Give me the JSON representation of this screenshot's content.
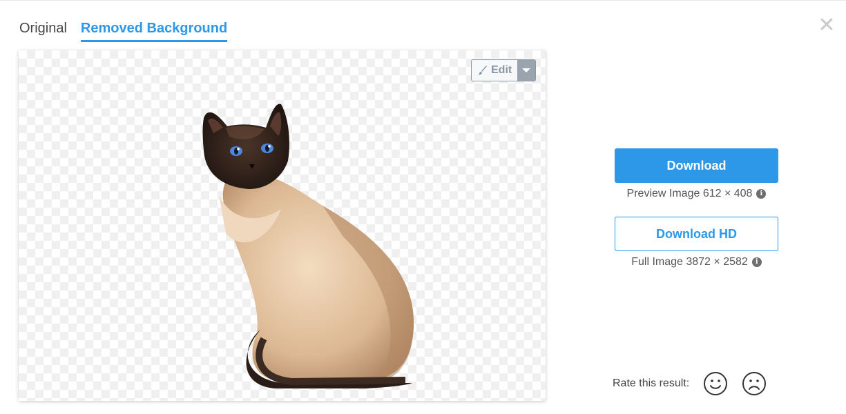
{
  "tabs": [
    {
      "label": "Original",
      "active": false
    },
    {
      "label": "Removed Background",
      "active": true
    }
  ],
  "close": {
    "icon": "close-icon",
    "glyph": "✕"
  },
  "editor": {
    "edit_label": "Edit",
    "edit_icon": "brush-icon",
    "dropdown_icon": "caret-down-icon"
  },
  "actions": {
    "download_label": "Download",
    "preview_text": "Preview Image 612 × 408",
    "download_hd_label": "Download HD",
    "full_text": "Full Image 3872 × 2582",
    "info_icon": "info-icon"
  },
  "rating": {
    "label": "Rate this result:",
    "positive_icon": "smiley-icon",
    "negative_icon": "frown-icon"
  },
  "colors": {
    "accent": "#2d97e8",
    "close": "#c9c9c9",
    "edit_caret_bg": "#9aa4ae"
  }
}
